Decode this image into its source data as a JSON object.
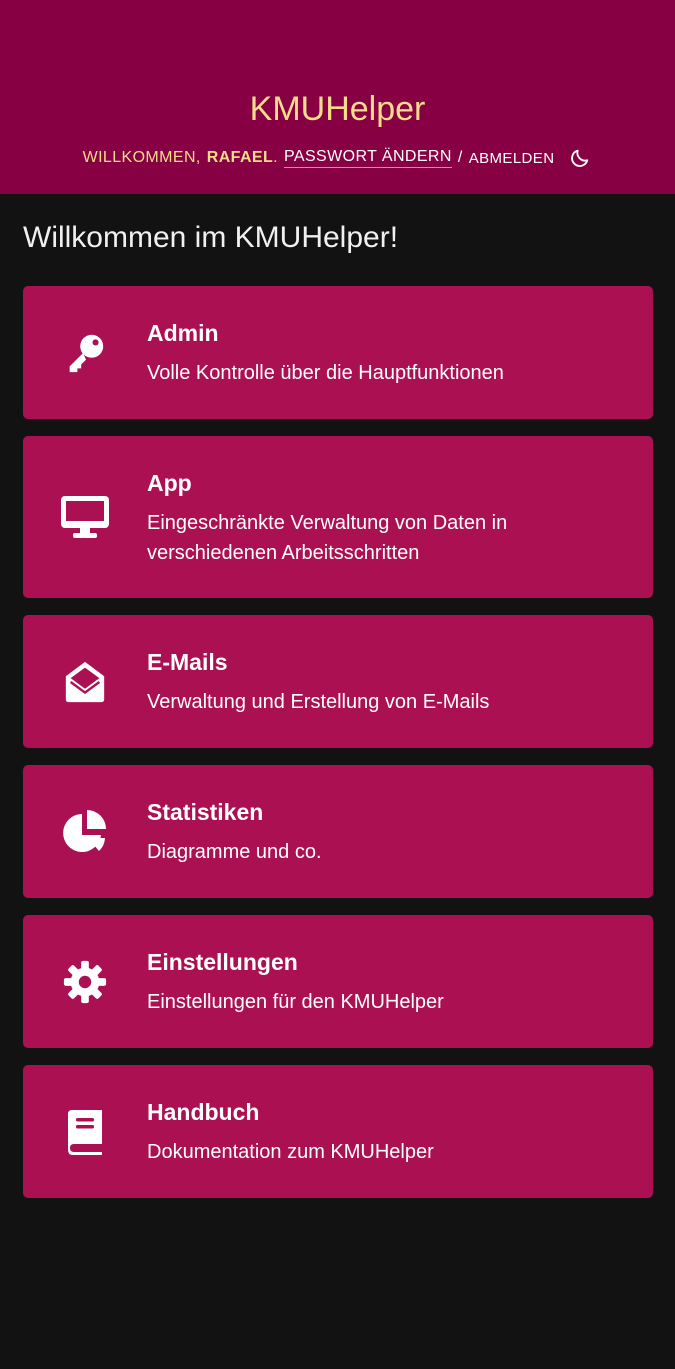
{
  "header": {
    "brand": "KMUHelper",
    "welcome_prefix": "Willkommen,",
    "username": "Rafael",
    "welcome_suffix": ".",
    "change_password": "Passwort ändern",
    "separator": "/",
    "logout": "Abmelden",
    "theme_icon": "moon-icon"
  },
  "page": {
    "title": "Willkommen im KMUHelper!"
  },
  "cards": [
    {
      "icon": "key-icon",
      "title": "Admin",
      "description": "Volle Kontrolle über die Hauptfunktionen"
    },
    {
      "icon": "desktop-icon",
      "title": "App",
      "description": "Eingeschränkte Verwaltung von Daten in verschiedenen Arbeitsschritten"
    },
    {
      "icon": "envelope-open-icon",
      "title": "E-Mails",
      "description": "Verwaltung und Erstellung von E-Mails"
    },
    {
      "icon": "pie-chart-icon",
      "title": "Statistiken",
      "description": "Diagramme und co."
    },
    {
      "icon": "gear-icon",
      "title": "Einstellungen",
      "description": "Einstellungen für den KMUHelper"
    },
    {
      "icon": "book-icon",
      "title": "Handbuch",
      "description": "Dokumentation zum KMUHelper"
    }
  ],
  "colors": {
    "header_bg": "#870043",
    "card_bg": "#ab1152",
    "page_bg": "#121212",
    "brand_text": "#f5dd8c"
  }
}
